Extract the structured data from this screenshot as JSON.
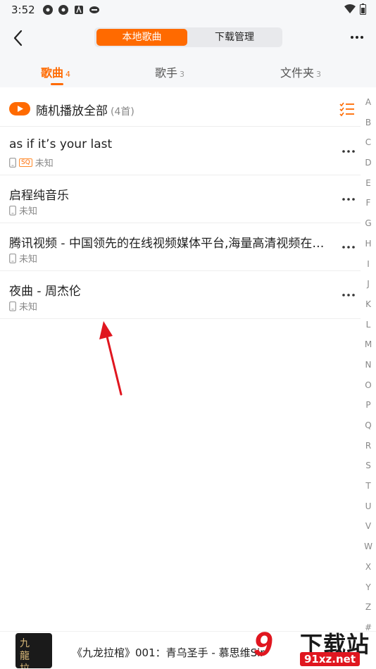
{
  "status_bar": {
    "time": "3:52"
  },
  "header": {
    "segments": [
      "本地歌曲",
      "下载管理"
    ],
    "active_segment": "本地歌曲"
  },
  "tabs": [
    {
      "label": "歌曲",
      "count": "4",
      "active": true
    },
    {
      "label": "歌手",
      "count": "3",
      "active": false
    },
    {
      "label": "文件夹",
      "count": "3",
      "active": false
    }
  ],
  "play_all": {
    "label": "随机播放全部",
    "count": "(4首)"
  },
  "songs": [
    {
      "title": "as if it’s your last",
      "artist": "未知",
      "badge": "SQ"
    },
    {
      "title": "启程纯音乐",
      "artist": "未知"
    },
    {
      "title": "腾讯视频 - 中国领先的在线视频媒体平台,海量高清视频在线观看",
      "artist": "未知"
    },
    {
      "title": "夜曲 - 周杰伦",
      "artist": "未知"
    }
  ],
  "alphabet": [
    "A",
    "B",
    "C",
    "D",
    "E",
    "F",
    "G",
    "H",
    "I",
    "J",
    "K",
    "L",
    "M",
    "N",
    "O",
    "P",
    "Q",
    "R",
    "S",
    "T",
    "U",
    "V",
    "W",
    "X",
    "Y",
    "Z",
    "#"
  ],
  "now_playing": {
    "title": "《九龙拉棺》001：青乌圣手 - 慕思维Sir",
    "cover_text": "九龍拉棺"
  },
  "watermark": {
    "logo": "9",
    "brand": "下载站",
    "domain": "91xz.net"
  },
  "colors": {
    "accent": "#ff6a00",
    "arrow": "#e0161f"
  }
}
